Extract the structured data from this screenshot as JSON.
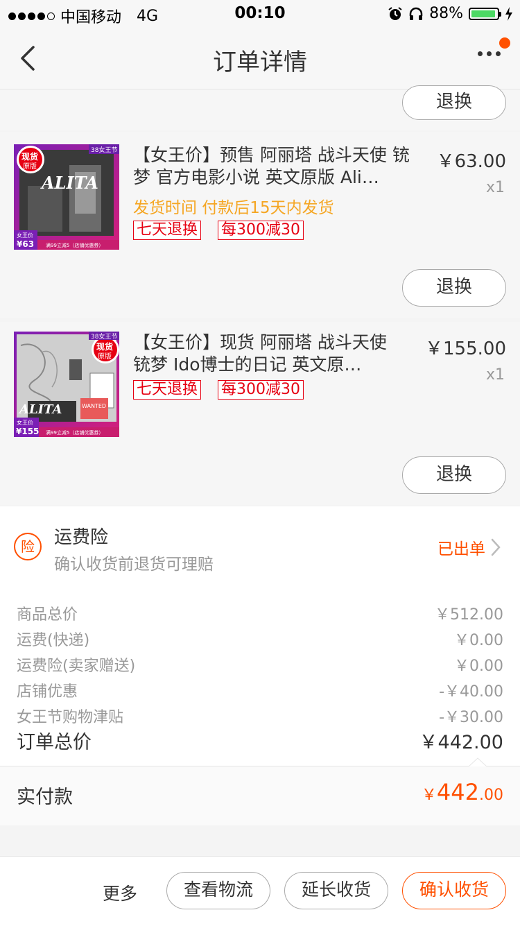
{
  "status_bar": {
    "carrier": "中国移动",
    "network": "4G",
    "time": "00:10",
    "battery_percent": "88%",
    "battery_level": 0.88
  },
  "nav": {
    "title": "订单详情"
  },
  "top_return_button": "退换",
  "products": [
    {
      "title": "【女王价】预售 阿丽塔 战斗天使 铳梦 官方电影小说 英文原版 Ali…",
      "price": "￥63.00",
      "qty": "x1",
      "ship": "发货时间 付款后15天内发货",
      "tags": [
        "七天退换",
        "每300减30"
      ],
      "return_label": "退换",
      "thumb": {
        "badge": "现货",
        "badge2": "原版",
        "corner": "38女王节",
        "logo": "ALITA",
        "price_mark": "63",
        "price_label": "女王价",
        "footer": "满99立减5（店铺优惠券）"
      }
    },
    {
      "title": "【女王价】现货 阿丽塔 战斗天使 铳梦 Ido博士的日记 英文原…",
      "price": "￥155.00",
      "qty": "x1",
      "tags": [
        "七天退换",
        "每300减30"
      ],
      "return_label": "退换",
      "thumb": {
        "badge": "现货",
        "badge2": "原版",
        "corner": "38女王节",
        "logo": "ALITA",
        "price_mark": "155",
        "price_label": "女王价",
        "footer": "满99立减5（店铺优惠券）"
      }
    }
  ],
  "insurance": {
    "icon_text": "险",
    "title": "运费险",
    "desc": "确认收货前退货可理赔",
    "status": "已出单"
  },
  "summary": [
    {
      "label": "商品总价",
      "value": "￥512.00"
    },
    {
      "label": "运费(快递)",
      "value": "￥0.00"
    },
    {
      "label": "运费险(卖家赠送)",
      "value": "￥0.00"
    },
    {
      "label": "店铺优惠",
      "value": "-￥40.00"
    },
    {
      "label": "女王节购物津贴",
      "value": "-￥30.00"
    }
  ],
  "order_total": {
    "label": "订单总价",
    "value": "￥442.00"
  },
  "paid": {
    "label": "实付款",
    "currency": "￥",
    "integer": "442",
    "decimal": ".00"
  },
  "actions": {
    "more": "更多",
    "logistics": "查看物流",
    "extend": "延长收货",
    "confirm": "确认收货"
  },
  "colors": {
    "accent": "#ff5000",
    "tag_red": "#e60012",
    "ship_orange": "#f5a623"
  }
}
